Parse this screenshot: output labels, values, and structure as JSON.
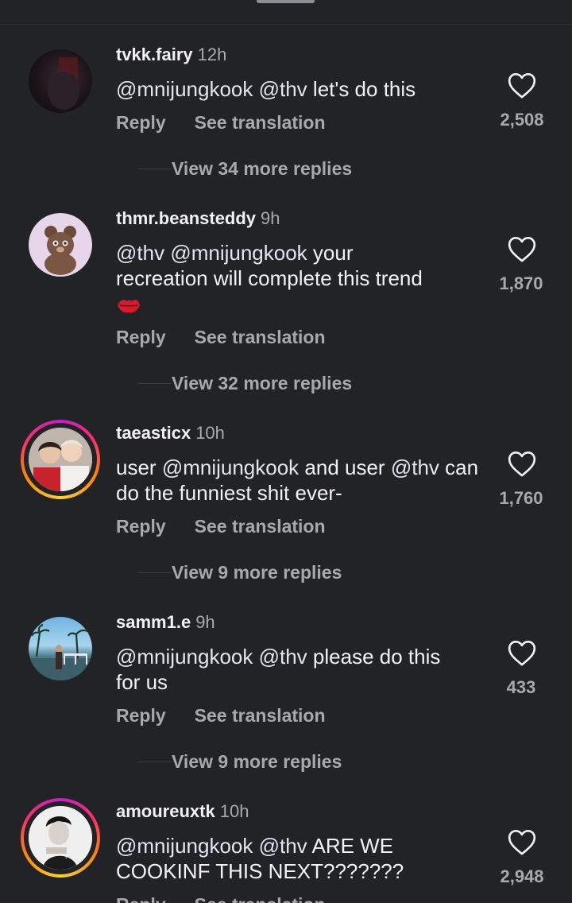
{
  "comments": [
    {
      "username": "tvkk.fairy",
      "time": "12h",
      "mentions": [
        "@mnijungkook",
        "@thv"
      ],
      "text_after": " let's do this",
      "reply_label": "Reply",
      "translate_label": "See translation",
      "likes": "2,508",
      "view_more": "View 34 more replies"
    },
    {
      "username": "thmr.beansteddy",
      "time": "9h",
      "mentions": [
        "@thv",
        "@mnijungkook"
      ],
      "text_after": " your recreation will complete this trend",
      "emoji": "kiss-mark",
      "reply_label": "Reply",
      "translate_label": "See translation",
      "likes": "1,870",
      "view_more": "View 32 more replies"
    },
    {
      "username": "taeasticx",
      "time": "10h",
      "text_before": "user ",
      "mention_a": "@mnijungkook",
      "text_mid": " and user ",
      "mention_b": "@thv",
      "text_after": " can do the funniest shit ever-",
      "reply_label": "Reply",
      "translate_label": "See translation",
      "likes": "1,760",
      "view_more": "View 9 more replies"
    },
    {
      "username": "samm1.e",
      "time": "9h",
      "mentions": [
        "@mnijungkook",
        "@thv"
      ],
      "text_after": " please do this for us",
      "reply_label": "Reply",
      "translate_label": "See translation",
      "likes": "433",
      "view_more": "View 9 more replies"
    },
    {
      "username": "amoureuxtk",
      "time": "10h",
      "mentions": [
        "@mnijungkook",
        "@thv"
      ],
      "text_after": " ARE WE COOKINF THIS NEXT???????",
      "reply_label": "Reply",
      "translate_label": "See translation",
      "likes": "2,948"
    }
  ],
  "colors": {
    "background": "#222327",
    "secondary_text": "#a8a9ae",
    "story_ring": [
      "#c41ec9",
      "#ff2d6a",
      "#ff8a00",
      "#ffd13d"
    ]
  },
  "icons": {
    "like": "heart-outline-icon",
    "grabber": "sheet-handle"
  }
}
